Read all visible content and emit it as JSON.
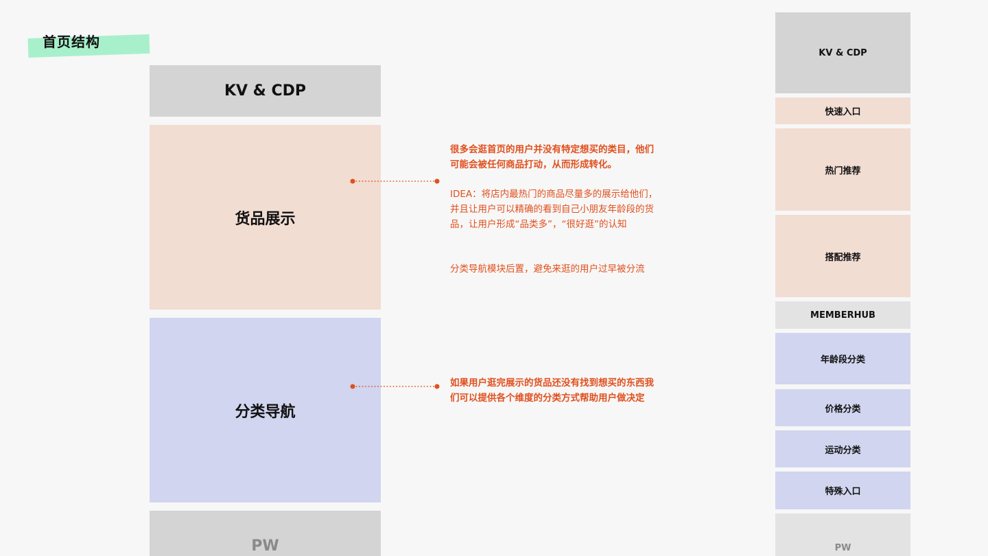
{
  "title": "首页结构",
  "colors": {
    "highlight": "#a8f0cc",
    "gray_block": "#d4d4d4",
    "peach_block": "#f2ddd3",
    "blue_block": "#d1d5ef",
    "annotation": "#e0501e"
  },
  "main_structure": {
    "kv": "KV & CDP",
    "goods": "货品展示",
    "category": "分类导航",
    "pw": "PW"
  },
  "notes": {
    "goods_heading": "很多会逛首页的用户并没有特定想买的类目，他们可能会被任何商品打动，从而形成转化。",
    "goods_idea": "IDEA：将店内最热门的商品尽量多的展示给他们，并且让用户可以精确的看到自己小朋友年龄段的货品，让用户形成“品类多”，“很好逛”的认知",
    "goods_nav": "分类导航模块后置，避免来逛的用户过早被分流",
    "category_heading": "如果用户逛完展示的货品还没有找到想买的东西我们可以提供各个维度的分类方式帮助用户做决定"
  },
  "side_structure": {
    "kv": "KV & CDP",
    "quick_entry": "快速入口",
    "hot_recommend": "热门推荐",
    "match_recommend": "搭配推荐",
    "memberhub": "MEMBERHUB",
    "age_category": "年龄段分类",
    "price_category": "价格分类",
    "sport_category": "运动分类",
    "special_entry": "特殊入口",
    "pw": "PW"
  }
}
